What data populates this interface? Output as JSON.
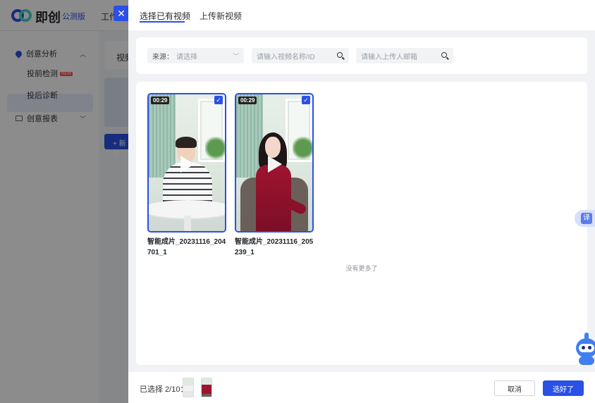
{
  "background": {
    "brand": "即创",
    "badge": "公测版",
    "menu_item": "工作",
    "sidebar": {
      "group1": "创意分析",
      "item_active": "投前检测",
      "item_active_badge": "NEW",
      "item2": "投后诊断",
      "group2": "创意报表"
    },
    "main_title": "视频",
    "new_button": "+ 新建"
  },
  "drawer": {
    "close_icon": "close-icon",
    "tabs": [
      {
        "label": "选择已有视频",
        "active": true
      },
      {
        "label": "上传新视频",
        "active": false
      }
    ],
    "filters": {
      "source_label": "来源：",
      "source_placeholder": "请选择",
      "name_placeholder": "请输入视频名称/ID",
      "email_placeholder": "请输入上传人邮箱"
    },
    "videos": [
      {
        "duration": "00:29",
        "title": "智能成片_20231116_204701_1",
        "selected": true
      },
      {
        "duration": "00:29",
        "title": "智能成片_20231116_205239_1",
        "selected": true
      }
    ],
    "no_more": "没有更多了",
    "footer": {
      "selected_label": "已选择 2/10：",
      "cancel": "取消",
      "confirm": "选好了"
    }
  },
  "widgets": {
    "translate": "译"
  },
  "colors": {
    "accent": "#2b50e6",
    "overlay": "rgba(0,0,0,0.45)"
  }
}
